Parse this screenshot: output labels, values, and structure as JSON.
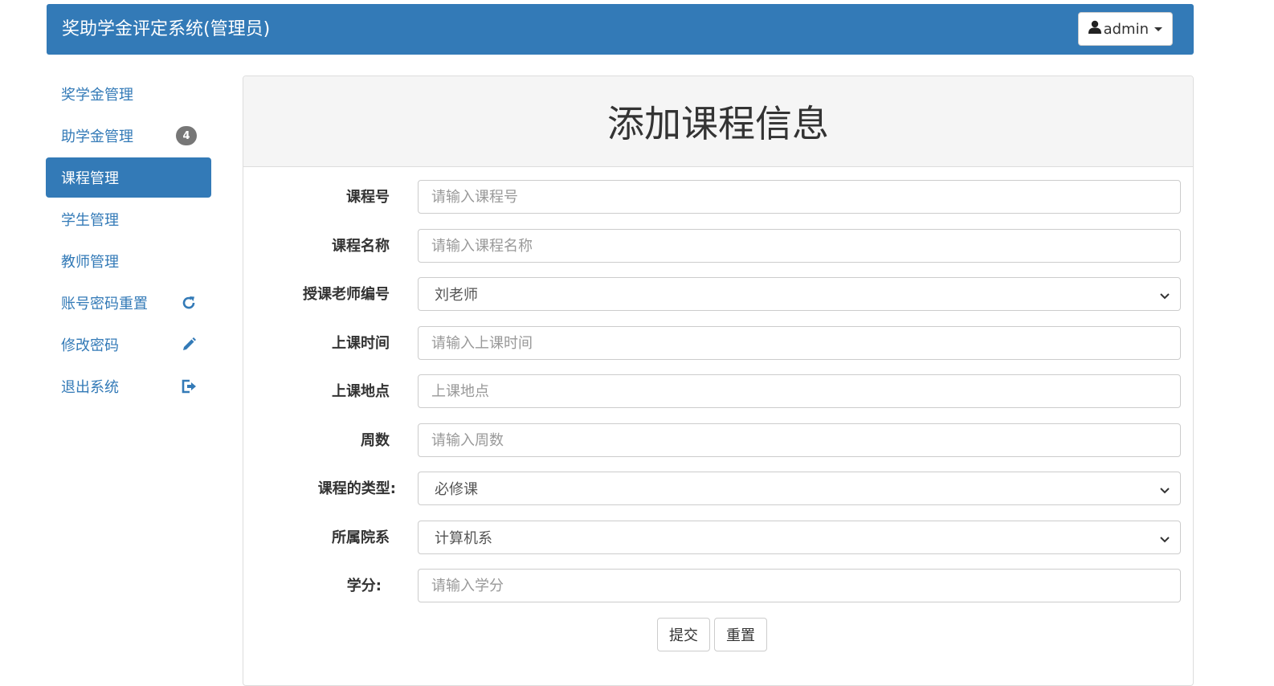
{
  "header": {
    "title": "奖助学金评定系统(管理员)",
    "user_label": "admin"
  },
  "colors": {
    "primary": "#337ab7",
    "badge": "#777777"
  },
  "sidebar": {
    "items": [
      {
        "label": "奖学金管理"
      },
      {
        "label": "助学金管理",
        "badge": "4"
      },
      {
        "label": "课程管理",
        "active": true
      },
      {
        "label": "学生管理"
      },
      {
        "label": "教师管理"
      },
      {
        "label": "账号密码重置",
        "icon": "refresh-icon"
      },
      {
        "label": "修改密码",
        "icon": "pencil-icon"
      },
      {
        "label": "退出系统",
        "icon": "logout-icon"
      }
    ]
  },
  "panel": {
    "title": "添加课程信息"
  },
  "form": {
    "course_no": {
      "label": "课程号",
      "placeholder": "请输入课程号"
    },
    "course_name": {
      "label": "课程名称",
      "placeholder": "请输入课程名称"
    },
    "teacher_no": {
      "label": "授课老师编号",
      "value": "刘老师"
    },
    "class_time": {
      "label": "上课时间",
      "placeholder": "请输入上课时间"
    },
    "class_place": {
      "label": "上课地点",
      "placeholder": "上课地点"
    },
    "weeks": {
      "label": "周数",
      "placeholder": "请输入周数"
    },
    "course_type": {
      "label": "课程的类型:",
      "value": "必修课"
    },
    "department": {
      "label": "所属院系",
      "value": "计算机系"
    },
    "credit": {
      "label": "学分:",
      "placeholder": "请输入学分"
    },
    "submit_label": "提交",
    "reset_label": "重置"
  }
}
